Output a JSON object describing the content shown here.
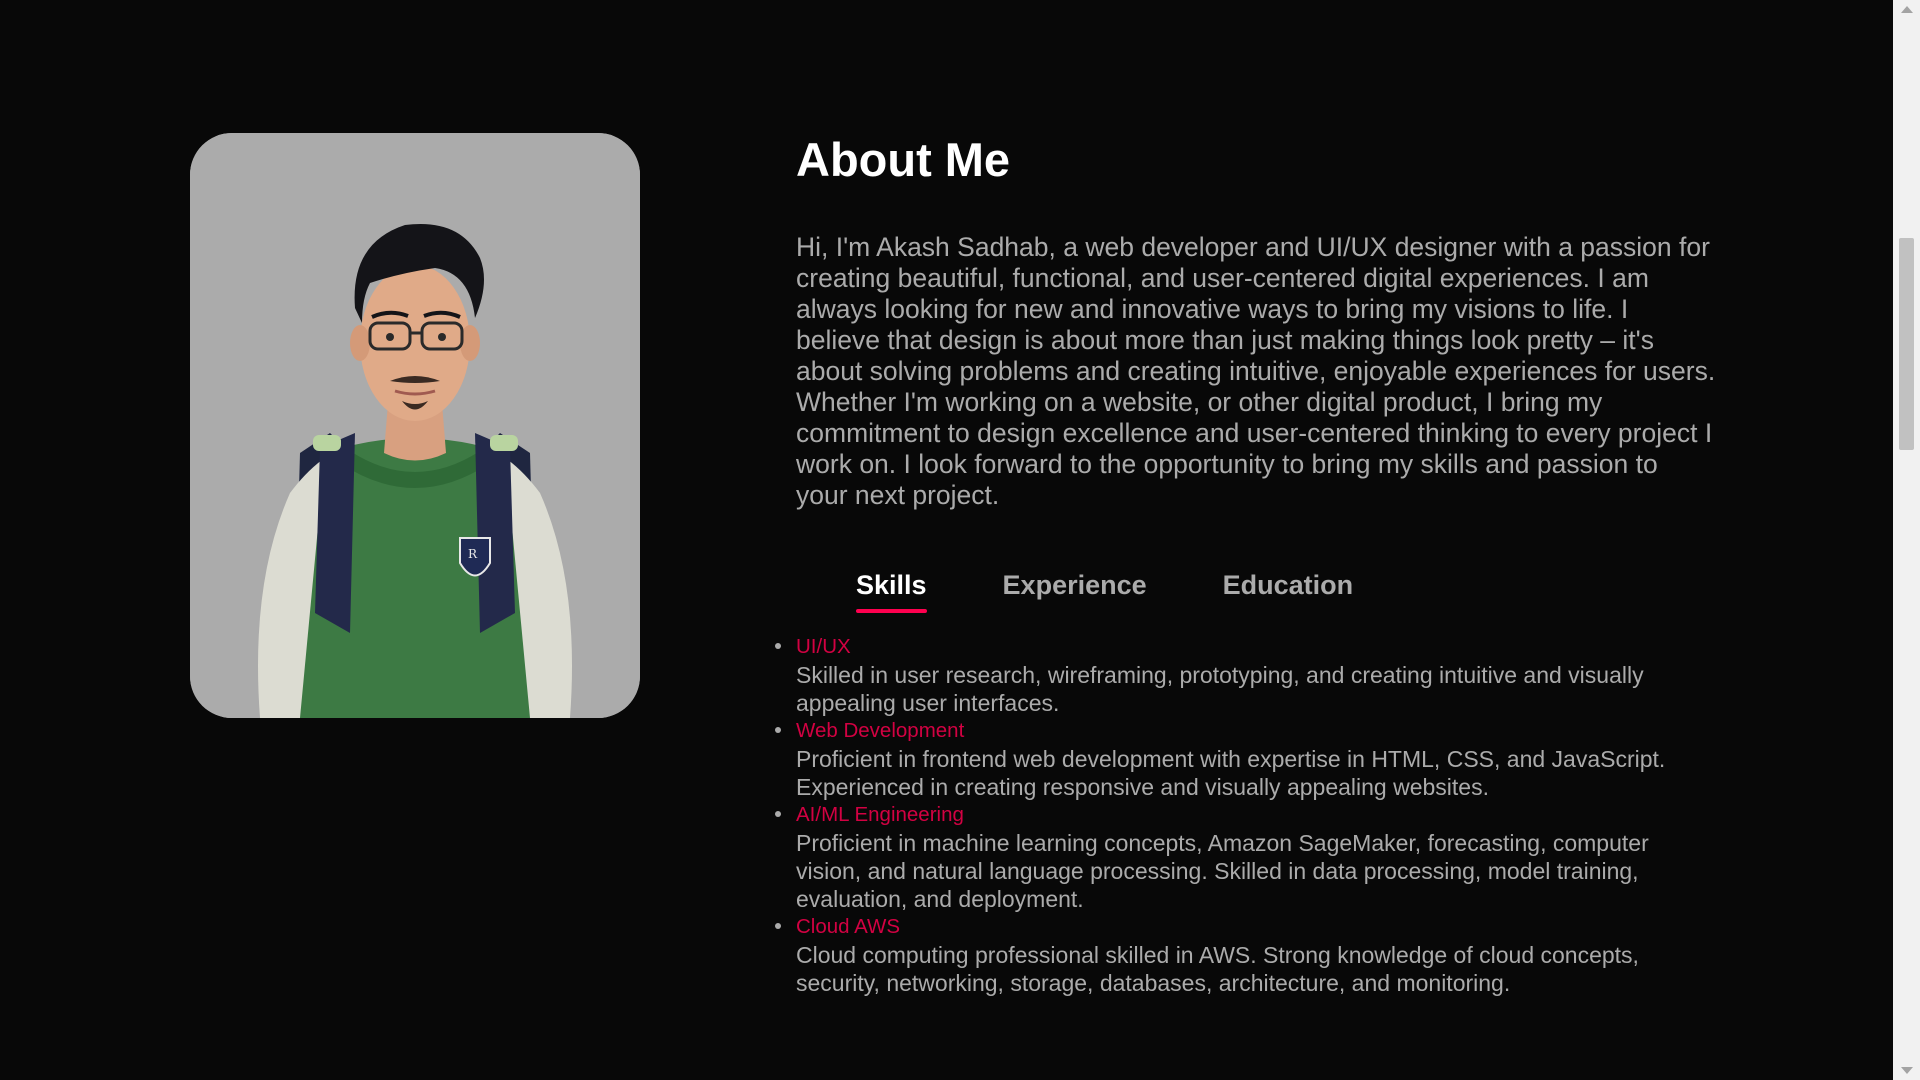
{
  "about": {
    "title": "About Me",
    "bio": "Hi, I'm Akash Sadhab, a web developer and UI/UX designer with a passion for creating beautiful, functional, and user-centered digital experiences. I am always looking for new and innovative ways to bring my visions to life. I believe that design is about more than just making things look pretty – it's about solving problems and creating intuitive, enjoyable experiences for users. Whether I'm working on a website, or other digital product, I bring my commitment to design excellence and user-centered thinking to every project I work on. I look forward to the opportunity to bring my skills and passion to your next project."
  },
  "tabs": [
    {
      "label": "Skills",
      "active": true
    },
    {
      "label": "Experience",
      "active": false
    },
    {
      "label": "Education",
      "active": false
    }
  ],
  "skills": [
    {
      "name": "UI/UX",
      "desc": "Skilled in user research, wireframing, prototyping, and creating intuitive and visually appealing user interfaces."
    },
    {
      "name": "Web Development",
      "desc": "Proficient in frontend web development with expertise in HTML, CSS, and JavaScript. Experienced in creating responsive and visually appealing websites."
    },
    {
      "name": "AI/ML Engineering",
      "desc": "Proficient in machine learning concepts, Amazon SageMaker, forecasting, computer vision, and natural language processing. Skilled in data processing, model training, evaluation, and deployment."
    },
    {
      "name": "Cloud AWS",
      "desc": "Cloud computing professional skilled in AWS. Strong knowledge of cloud concepts, security, networking, storage, databases, architecture, and monitoring."
    }
  ],
  "colors": {
    "accent": "#ff004f",
    "background": "#080808",
    "text": "#ababab",
    "heading": "#ffffff"
  },
  "icons": {
    "avatar": "3d-avatar-portrait",
    "scroll_up": "chevron-up-icon",
    "scroll_down": "chevron-down-icon"
  }
}
